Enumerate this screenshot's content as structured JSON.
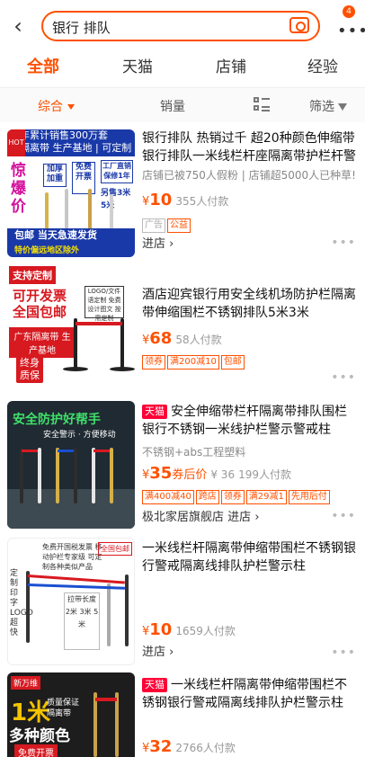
{
  "search": {
    "query": "银行 排队",
    "badge": "4"
  },
  "tabs": [
    "全部",
    "天猫",
    "店铺",
    "经验"
  ],
  "sort": {
    "composite": "综合",
    "sales": "销量",
    "filter": "筛选"
  },
  "items": [
    {
      "title": "银行排队 热销过千 超20种颜色伸缩带银行排队一米线栏杆座隔离带护栏杆警",
      "sub": "店铺已被750人假粉 | 店铺超5000人已种草!",
      "price_int": "10",
      "buyers": "355人付款",
      "tags": [
        "广告",
        "公益"
      ],
      "store": "进店",
      "thumb": {
        "banner_line1": "年累计销售300万套",
        "banner_line2": "隔离带 生产基地 | 可定制logo",
        "hot": "HOT",
        "big": "惊爆价",
        "box1": "加厚加重",
        "box2": "免费开票",
        "box3": "工厂直销保修1年",
        "side": "另售3米5米",
        "foot1": "包邮   当天急速发货",
        "foot2": "特价偏远地区除外"
      }
    },
    {
      "title": "酒店迎宾银行用安全线机场防护栏隔离带伸缩围栏不锈钢排队5米3米",
      "price_int": "68",
      "buyers": "58人付款",
      "tags": [
        "领券",
        "满200减10",
        "包邮"
      ],
      "thumb": {
        "b1": "支持定制",
        "b2": "可开发票 全国包邮",
        "b3": "广东隔离带 生产基地",
        "b4": "终身质保",
        "sign": "LOGO/文件 语定制 免费设计图文 按需定制"
      }
    },
    {
      "tmall": "天猫",
      "title": "安全伸缩带栏杆隔离带排队围栏银行不锈钢一米线护栏警示警戒柱",
      "sub": "不锈钢+abs工程塑料",
      "price_int": "35",
      "price_suffix": "券后价",
      "old_price": "¥ 36",
      "buyers": "199人付款",
      "tags": [
        "满400减40",
        "跨店",
        "领券",
        "满29减1",
        "先用后付"
      ],
      "store": "极北家居旗舰店",
      "store_enter": "进店",
      "thumb": {
        "hdr": "安全防护好帮手",
        "hdr2": "安全警示 · 方便移动"
      }
    },
    {
      "title": "一米线栏杆隔离带伸缩带围栏不锈钢银行警戒隔离线排队护栏警示柱",
      "price_int": "10",
      "buyers": "1659人付款",
      "store": "进店",
      "thumb": {
        "vert": "定制印字LOGO超快",
        "topnote": "免费开国税发票 移动护栏专家级 可定制各种类似产品",
        "badge": "全国包邮",
        "len": "拉带长度 2米 3米 5米"
      }
    },
    {
      "tmall": "天猫",
      "title": "一米线栏杆隔离带伸缩带围栏不锈钢银行警戒隔离线排队护栏警示柱",
      "price_int": "32",
      "buyers": "2766人付款",
      "thumb": {
        "logo": "新万维",
        "y1": "1米",
        "y2": "质量保证 隔离带",
        "y3": "多种颜色",
        "y4": "免费开票"
      }
    }
  ],
  "colors": {
    "accent": "#ff5000",
    "tmall": "#ff0036"
  }
}
